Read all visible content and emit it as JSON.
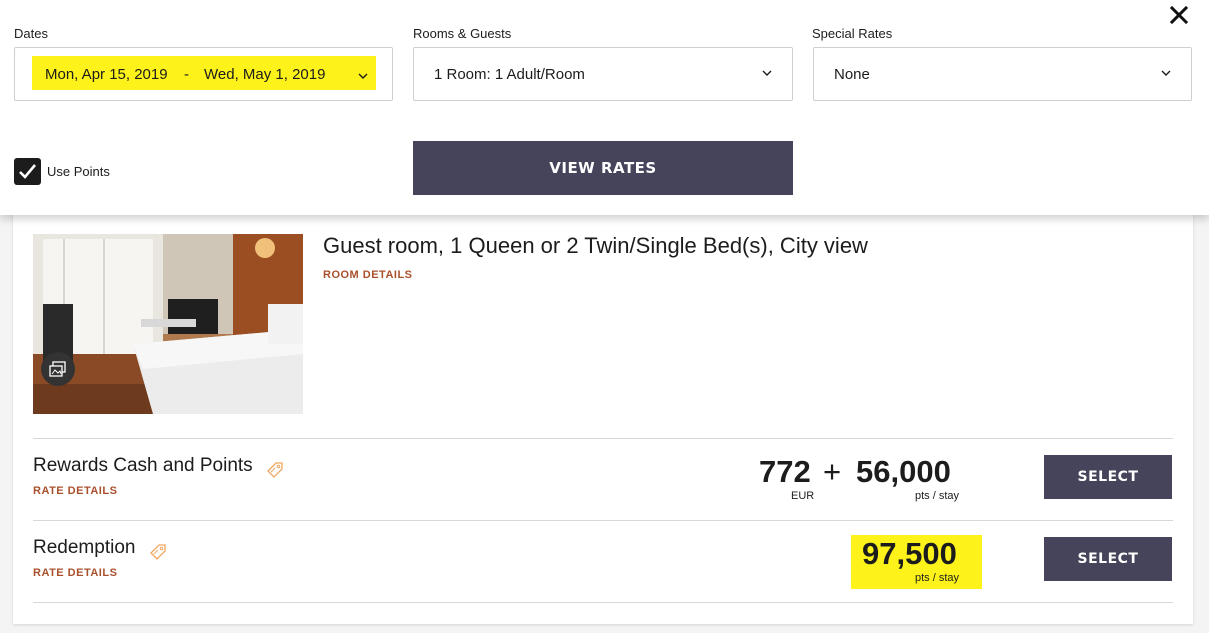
{
  "search": {
    "dates_label": "Dates",
    "date_start": "Mon, Apr 15, 2019",
    "date_separator": "-",
    "date_end": "Wed, May 1, 2019",
    "rooms_label": "Rooms & Guests",
    "rooms_value": "1 Room: 1 Adult/Room",
    "special_rates_label": "Special Rates",
    "special_rates_value": "None",
    "use_points_label": "Use Points",
    "use_points_checked": true,
    "view_rates_label": "VIEW RATES"
  },
  "room": {
    "title": "Guest room, 1 Queen or 2 Twin/Single Bed(s), City view",
    "details_link": "ROOM DETAILS",
    "rates": [
      {
        "name": "Rewards Cash and Points",
        "details_link": "RATE DETAILS",
        "cash_amount": "772",
        "cash_currency": "EUR",
        "plus": "+",
        "points_amount": "56,000",
        "points_unit": "pts / stay",
        "select_label": "SELECT"
      },
      {
        "name": "Redemption",
        "details_link": "RATE DETAILS",
        "points_amount": "97,500",
        "points_unit": "pts / stay",
        "select_label": "SELECT"
      }
    ]
  },
  "colors": {
    "highlight": "#fdf31a",
    "button": "#45445a",
    "link": "#a9502c"
  },
  "icons": [
    "close-icon",
    "chevron-down-icon",
    "checkmark-icon",
    "gallery-icon",
    "tag-icon"
  ]
}
